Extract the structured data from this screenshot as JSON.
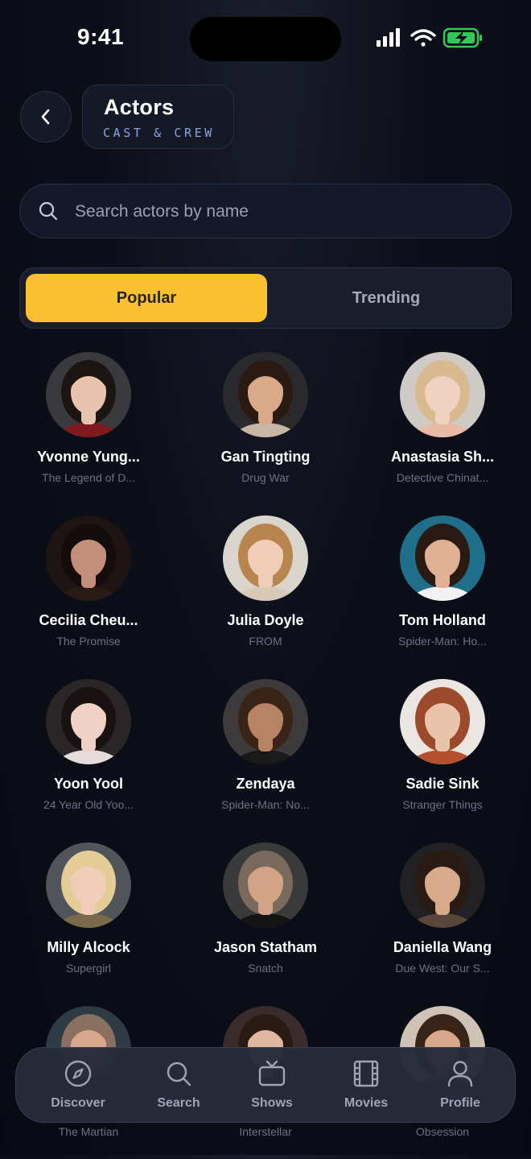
{
  "status_bar": {
    "time": "9:41"
  },
  "header": {
    "title": "Actors",
    "subtitle": "CAST & CREW"
  },
  "search": {
    "placeholder": "Search actors by name",
    "value": ""
  },
  "tabs": [
    {
      "label": "Popular",
      "active": true
    },
    {
      "label": "Trending",
      "active": false
    }
  ],
  "actors": [
    {
      "name": "Yvonne Yung...",
      "work": "The Legend of D...",
      "bg": "#3a3a3e",
      "hair": "#1c1512",
      "skin": "#e8c3ad",
      "cloth": "#7e1a20"
    },
    {
      "name": "Gan Tingting",
      "work": "Drug War",
      "bg": "#2a2a2e",
      "hair": "#2b1a12",
      "skin": "#d9a98a",
      "cloth": "#c9b5a5"
    },
    {
      "name": "Anastasia Sh...",
      "work": "Detective Chinat...",
      "bg": "#cfcac6",
      "hair": "#d9b98f",
      "skin": "#efd2bf",
      "cloth": "#e8b9a6"
    },
    {
      "name": "Cecilia Cheu...",
      "work": "The Promise",
      "bg": "#1d1413",
      "hair": "#150d0b",
      "skin": "#c48f7a",
      "cloth": "#2a1a16"
    },
    {
      "name": "Julia Doyle",
      "work": "FROM",
      "bg": "#d9d4cc",
      "hair": "#b9854f",
      "skin": "#efcdb7",
      "cloth": "#d8c8b8"
    },
    {
      "name": "Tom Holland",
      "work": "Spider-Man: Ho...",
      "bg": "#1f6e8a",
      "hair": "#2a1a12",
      "skin": "#e0b094",
      "cloth": "#f2f2f2"
    },
    {
      "name": "Yoon Yool",
      "work": "24 Year Old Yoo...",
      "bg": "#2a2628",
      "hair": "#1a1212",
      "skin": "#f0d2c4",
      "cloth": "#e6dcdc"
    },
    {
      "name": "Zendaya",
      "work": "Spider-Man: No...",
      "bg": "#3d3a3c",
      "hair": "#3a2418",
      "skin": "#b88264",
      "cloth": "#1a1a1a"
    },
    {
      "name": "Sadie Sink",
      "work": "Stranger Things",
      "bg": "#ece6e2",
      "hair": "#9c4a2c",
      "skin": "#eac3ad",
      "cloth": "#b4502e"
    },
    {
      "name": "Milly Alcock",
      "work": "Supergirl",
      "bg": "#51555a",
      "hair": "#e3cc96",
      "skin": "#efcdb9",
      "cloth": "#7b6a4a"
    },
    {
      "name": "Jason Statham",
      "work": "Snatch",
      "bg": "#3a3a3a",
      "hair": "#7a6a5e",
      "skin": "#d2a386",
      "cloth": "#141414"
    },
    {
      "name": "Daniella Wang",
      "work": "Due West: Our S...",
      "bg": "#222022",
      "hair": "#2a1a14",
      "skin": "#d9a98c",
      "cloth": "#5a4638"
    },
    {
      "name": "",
      "work": "The Martian",
      "bg": "#2e3a44",
      "hair": "#8a7060",
      "skin": "#d8a88c",
      "cloth": "#222"
    },
    {
      "name": "",
      "work": "Interstellar",
      "bg": "#3a2c2c",
      "hair": "#2a1a14",
      "skin": "#e0b8a2",
      "cloth": "#222"
    },
    {
      "name": "",
      "work": "Obsession",
      "bg": "#cfc2b6",
      "hair": "#3a2418",
      "skin": "#d8a88c",
      "cloth": "#222"
    }
  ],
  "nav": [
    {
      "label": "Discover",
      "icon": "compass-icon"
    },
    {
      "label": "Search",
      "icon": "search-icon"
    },
    {
      "label": "Shows",
      "icon": "tv-icon"
    },
    {
      "label": "Movies",
      "icon": "film-icon"
    },
    {
      "label": "Profile",
      "icon": "user-icon"
    }
  ],
  "colors": {
    "accent": "#fbc02d",
    "background": "#0b0d17",
    "muted_text": "#6c7185"
  }
}
